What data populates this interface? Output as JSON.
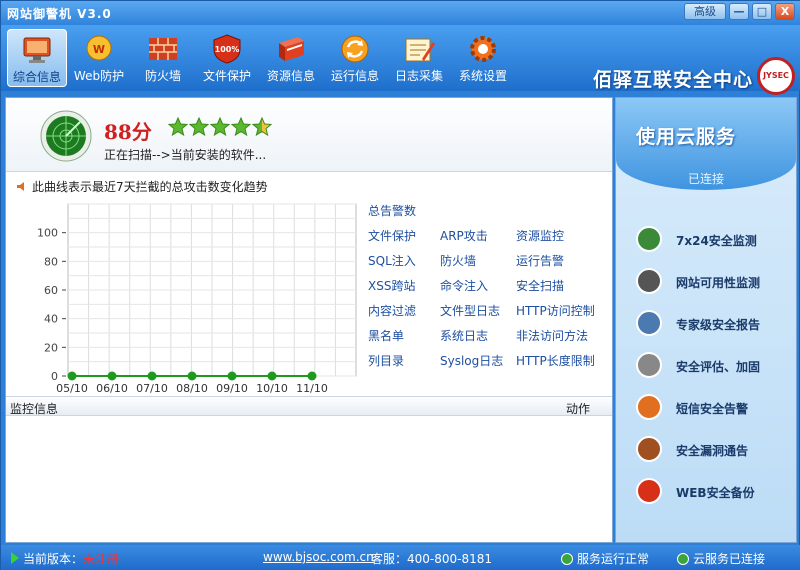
{
  "window": {
    "title": "网站御警机 V3.0",
    "advanced_label": "高级",
    "min_label": "—",
    "max_label": "□",
    "close_label": "X"
  },
  "toolbar": {
    "items": [
      {
        "label": "综合信息",
        "icon": "monitor-icon"
      },
      {
        "label": "Web防护",
        "icon": "web-shield-icon"
      },
      {
        "label": "防火墙",
        "icon": "firewall-icon"
      },
      {
        "label": "文件保护",
        "icon": "file-shield-icon"
      },
      {
        "label": "资源信息",
        "icon": "resource-icon"
      },
      {
        "label": "运行信息",
        "icon": "refresh-icon"
      },
      {
        "label": "日志采集",
        "icon": "log-icon"
      },
      {
        "label": "系统设置",
        "icon": "gear-icon"
      }
    ],
    "brand": "佰驿互联安全中心",
    "brand_logo": "JYSEC"
  },
  "score": {
    "value": "88分",
    "stars": 4.5,
    "scan_text": "正在扫描-->当前安装的软件..."
  },
  "trend": {
    "label": "此曲线表示最近7天拦截的总攻击数变化趋势"
  },
  "chart_data": {
    "type": "line",
    "categories": [
      "05/10",
      "06/10",
      "07/10",
      "08/10",
      "09/10",
      "10/10",
      "11/10"
    ],
    "series": [
      {
        "values": [
          0,
          0,
          0,
          0,
          0,
          0,
          0
        ],
        "color": "#1e9a1e"
      }
    ],
    "yticks": [
      0,
      20,
      40,
      60,
      80,
      100
    ],
    "ylim": [
      0,
      120
    ],
    "grid": true
  },
  "legend": {
    "title": "总告警数",
    "rows": [
      [
        "文件保护",
        "ARP攻击",
        "资源监控"
      ],
      [
        "SQL注入",
        "防火墙",
        "运行告警"
      ],
      [
        "XSS跨站",
        "命令注入",
        "安全扫描"
      ],
      [
        "内容过滤",
        "文件型日志",
        "HTTP访问控制"
      ],
      [
        "黑名单",
        "系统日志",
        "非法访问方法"
      ],
      [
        "列目录",
        "Syslog日志",
        "HTTP长度限制"
      ]
    ]
  },
  "monitor": {
    "col_info": "监控信息",
    "col_action": "动作"
  },
  "side": {
    "cloud_title": "使用云服务",
    "connected": "已连接",
    "services": [
      {
        "label": "7x24安全监测",
        "icon": "clock-icon"
      },
      {
        "label": "网站可用性监测",
        "icon": "terminal-icon"
      },
      {
        "label": "专家级安全报告",
        "icon": "report-icon"
      },
      {
        "label": "安全评估、加固",
        "icon": "gears-icon"
      },
      {
        "label": "短信安全告警",
        "icon": "sms-alert-icon"
      },
      {
        "label": "安全漏洞通告",
        "icon": "bug-icon"
      },
      {
        "label": "WEB安全备份",
        "icon": "backup-icon"
      }
    ]
  },
  "status": {
    "version_label": "当前版本：",
    "version_value": "未注册",
    "website": "www.bjsoc.com.cn",
    "service_phone": "客服：400-800-8181",
    "run_status": "服务运行正常",
    "cloud_status": "云服务已连接"
  }
}
